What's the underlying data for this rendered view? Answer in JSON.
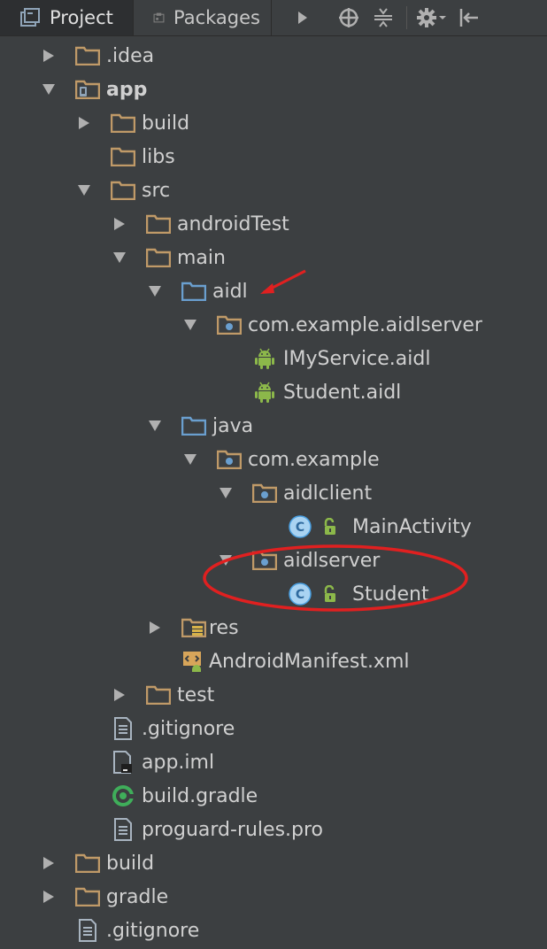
{
  "toolbar": {
    "tab_project": "Project",
    "tab_packages": "Packages",
    "icons": [
      "project-view-icon",
      "packages-icon",
      "more-tabs-arrow-icon",
      "locate-icon",
      "collapse-all-icon",
      "gear-icon",
      "hide-panel-icon"
    ]
  },
  "tree": {
    "idea": ".idea",
    "app": "app",
    "app_build": "build",
    "libs": "libs",
    "src": "src",
    "androidTest": "androidTest",
    "main": "main",
    "aidl": "aidl",
    "aidl_pkg": "com.example.aidlserver",
    "imyservice": "IMyService.aidl",
    "student_aidl": "Student.aidl",
    "java": "java",
    "java_pkg": "com.example",
    "aidlclient": "aidlclient",
    "mainactivity": "MainActivity",
    "aidlserver": "aidlserver",
    "student_class": "Student",
    "res": "res",
    "manifest": "AndroidManifest.xml",
    "test": "test",
    "app_gitignore": ".gitignore",
    "app_iml": "app.iml",
    "build_gradle": "build.gradle",
    "proguard": "proguard-rules.pro",
    "root_build": "build",
    "gradle": "gradle",
    "root_gitignore": ".gitignore"
  },
  "colors": {
    "background": "#3c3f41",
    "folder": "#c09a68",
    "source_folder": "#6a9fcf",
    "android_green": "#8cb84a",
    "class_blue": "#4a9fe0",
    "annotation_red": "#e02020"
  }
}
